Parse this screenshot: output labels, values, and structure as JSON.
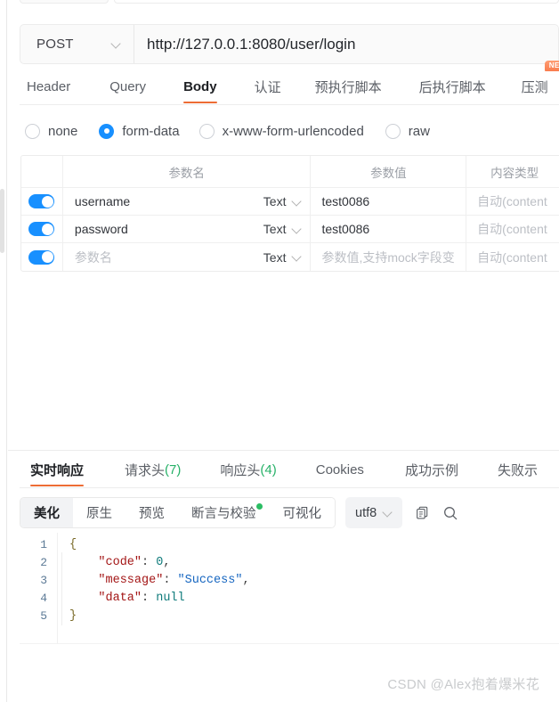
{
  "request": {
    "method": "POST",
    "url": "http://127.0.0.1:8080/user/login",
    "tabs": [
      {
        "label": "Header",
        "active": false
      },
      {
        "label": "Query",
        "active": false
      },
      {
        "label": "Body",
        "active": true
      },
      {
        "label": "认证",
        "active": false
      },
      {
        "label": "预执行脚本",
        "active": false
      },
      {
        "label": "后执行脚本",
        "active": false
      },
      {
        "label": "压测",
        "active": false,
        "badge": "NEW"
      }
    ],
    "body_types": [
      {
        "label": "none",
        "selected": false
      },
      {
        "label": "form-data",
        "selected": true
      },
      {
        "label": "x-www-form-urlencoded",
        "selected": false
      },
      {
        "label": "raw",
        "selected": false
      }
    ],
    "params_table": {
      "headers": [
        "",
        "参数名",
        "参数值",
        "内容类型"
      ],
      "rows": [
        {
          "enabled": true,
          "name": "username",
          "type": "Text",
          "value": "test0086",
          "content_type": "自动(content",
          "placeholder_row": false
        },
        {
          "enabled": true,
          "name": "password",
          "type": "Text",
          "value": "test0086",
          "content_type": "自动(content",
          "placeholder_row": false
        },
        {
          "enabled": true,
          "name": "参数名",
          "type": "Text",
          "value": "参数值,支持mock字段变",
          "content_type": "自动(content",
          "placeholder_row": true
        }
      ]
    }
  },
  "response": {
    "tabs": [
      {
        "label": "实时响应",
        "count": "",
        "active": true
      },
      {
        "label": "请求头",
        "count": "(7)",
        "active": false
      },
      {
        "label": "响应头",
        "count": "(4)",
        "active": false
      },
      {
        "label": "Cookies",
        "count": "",
        "active": false
      },
      {
        "label": "成功示例",
        "count": "",
        "active": false
      },
      {
        "label": "失败示",
        "count": "",
        "active": false
      }
    ],
    "view_modes": [
      {
        "label": "美化",
        "active": true,
        "badge": false
      },
      {
        "label": "原生",
        "active": false,
        "badge": false
      },
      {
        "label": "预览",
        "active": false,
        "badge": false
      },
      {
        "label": "断言与校验",
        "active": false,
        "badge": true
      },
      {
        "label": "可视化",
        "active": false,
        "badge": false
      }
    ],
    "encoding": "utf8",
    "copy_icon": "copy-icon",
    "search_icon": "search-icon",
    "body": {
      "line_numbers": [
        "1",
        "2",
        "3",
        "4",
        "5"
      ],
      "lines": [
        {
          "raw": "{"
        },
        {
          "key": "\"code\"",
          "value": "0",
          "value_kind": "num",
          "trail": ","
        },
        {
          "key": "\"message\"",
          "value": "\"Success\"",
          "value_kind": "str",
          "trail": ","
        },
        {
          "key": "\"data\"",
          "value": "null",
          "value_kind": "null",
          "trail": ""
        },
        {
          "raw": "}"
        }
      ]
    }
  },
  "watermark": "CSDN @Alex抱着爆米花",
  "colors": {
    "accent_orange": "#ed6c35",
    "toggle_blue": "#1890ff",
    "badge_green": "#2bbd63",
    "count_green": "#27b168",
    "new_badge": "#f97d4e"
  }
}
